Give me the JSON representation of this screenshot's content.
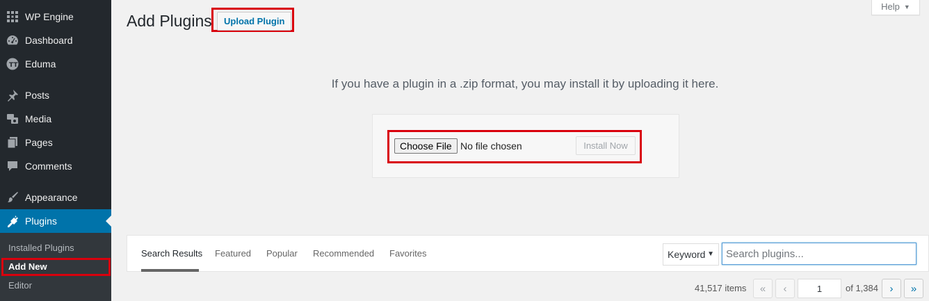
{
  "sidebar": {
    "items": [
      {
        "label": "WP Engine",
        "icon": "wp-engine-icon"
      },
      {
        "label": "Dashboard",
        "icon": "dashboard-icon"
      },
      {
        "label": "Eduma",
        "icon": "eduma-icon"
      },
      {
        "label": "Posts",
        "icon": "pushpin-icon"
      },
      {
        "label": "Media",
        "icon": "media-icon"
      },
      {
        "label": "Pages",
        "icon": "pages-icon"
      },
      {
        "label": "Comments",
        "icon": "comments-icon"
      },
      {
        "label": "Appearance",
        "icon": "paintbrush-icon"
      },
      {
        "label": "Plugins",
        "icon": "plugins-icon"
      }
    ],
    "submenu": [
      "Installed Plugins",
      "Add New",
      "Editor"
    ]
  },
  "header": {
    "title": "Add Plugins",
    "upload_button": "Upload Plugin",
    "help": "Help"
  },
  "upload": {
    "description": "If you have a plugin in a .zip format, you may install it by uploading it here.",
    "choose_file": "Choose File",
    "no_file": "No file chosen",
    "install_now": "Install Now"
  },
  "filters": {
    "tabs": [
      "Search Results",
      "Featured",
      "Popular",
      "Recommended",
      "Favorites"
    ],
    "keyword": "Keyword",
    "search_placeholder": "Search plugins..."
  },
  "pagination": {
    "items": "41,517 items",
    "first": "«",
    "prev": "‹",
    "current_page": "1",
    "of": "of 1,384",
    "next": "›",
    "last": "»"
  },
  "colors": {
    "sidebar_bg": "#23282d",
    "active_blue": "#0073aa",
    "highlight_red": "#d9000d"
  }
}
